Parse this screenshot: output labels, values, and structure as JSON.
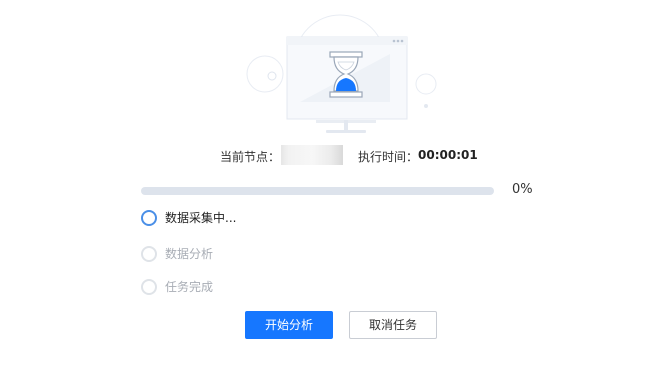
{
  "status": {
    "node_label": "当前节点：",
    "time_label": "执行时间：",
    "time_value": "00:00:01"
  },
  "progress": {
    "value": 0,
    "text": "0%"
  },
  "steps": [
    {
      "label": "数据采集中...",
      "state": "active"
    },
    {
      "label": "数据分析",
      "state": "pending"
    },
    {
      "label": "任务完成",
      "state": "pending"
    }
  ],
  "actions": {
    "start_label": "开始分析",
    "cancel_label": "取消任务"
  },
  "colors": {
    "primary": "#1677ff",
    "active_step": "#4a8fe7",
    "track": "#dde3ec"
  }
}
